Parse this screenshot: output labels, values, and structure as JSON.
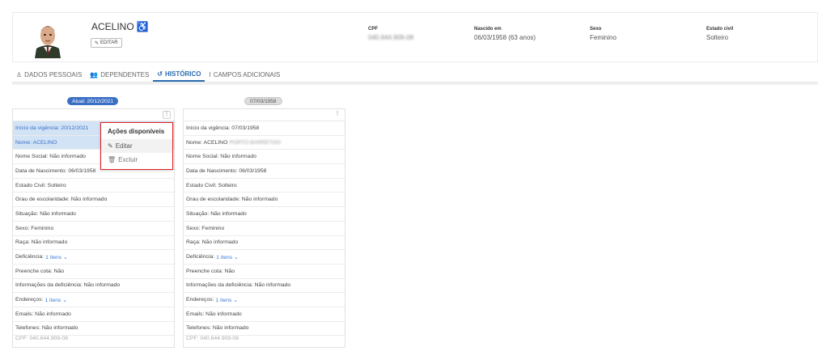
{
  "person": {
    "name": "ACELINO",
    "edit_label": "EDITAR",
    "fields": [
      {
        "label": "CPF",
        "value": "040.644.909-08",
        "blurred": true
      },
      {
        "label": "Nascido em",
        "value": "06/03/1958 (63 anos)",
        "blurred": false
      },
      {
        "label": "Sexo",
        "value": "Feminino",
        "blurred": false
      },
      {
        "label": "Estado civil",
        "value": "Solteiro",
        "blurred": false
      }
    ]
  },
  "tabs": [
    {
      "label": "DADOS PESSOAIS",
      "icon": "person-icon"
    },
    {
      "label": "DEPENDENTES",
      "icon": "group-icon"
    },
    {
      "label": "HISTÓRICO",
      "icon": "history-icon",
      "active": true
    },
    {
      "label": "CAMPOS ADICIONAIS",
      "icon": "text-cursor-icon"
    }
  ],
  "timeline": {
    "current": "Atual: 20/12/2021",
    "previous": "07/03/1958"
  },
  "cards": [
    {
      "rows": [
        {
          "text": "Início da vigência: 20/12/2021",
          "hl": true
        },
        {
          "text": "Nome: ACELINO",
          "hl": true
        },
        {
          "text": "Nome Social: Não informado"
        },
        {
          "text": "Data de Nascimento: 06/03/1958"
        },
        {
          "text": "Estado Civil: Solteiro"
        },
        {
          "text": "Grau de escolaridade: Não informado"
        },
        {
          "text": "Situação: Não informado"
        },
        {
          "text": "Sexo: Feminino"
        },
        {
          "text": "Raça: Não informado"
        },
        {
          "text": "Deficiência:",
          "link": "1 itens ⌄"
        },
        {
          "text": "Preenche cota: Não"
        },
        {
          "text": "Informações da deficiência: Não informado"
        },
        {
          "text": "Endereços:",
          "link": "1 itens ⌄"
        },
        {
          "text": "Emails: Não informado"
        },
        {
          "text": "Telefones: Não informado"
        }
      ],
      "cut": "CPF: 040.644.909-08"
    },
    {
      "rows": [
        {
          "text": "Início da vigência: 07/03/1958"
        },
        {
          "text": "Nome: ACELINO",
          "blur": "PORTO BARRETOO"
        },
        {
          "text": "Nome Social: Não informado"
        },
        {
          "text": "Data de Nascimento: 06/03/1958"
        },
        {
          "text": "Estado Civil: Solteiro"
        },
        {
          "text": "Grau de escolaridade: Não informado"
        },
        {
          "text": "Situação: Não informado"
        },
        {
          "text": "Sexo: Feminino"
        },
        {
          "text": "Raça: Não informado"
        },
        {
          "text": "Deficiência:",
          "link": "1 itens ⌄"
        },
        {
          "text": "Preenche cota: Não"
        },
        {
          "text": "Informações da deficiência: Não informado"
        },
        {
          "text": "Endereços:",
          "link": "1 itens ⌄"
        },
        {
          "text": "Emails: Não informado"
        },
        {
          "text": "Telefones: Não informado"
        }
      ],
      "cut": "CPF: 040.644.909-08"
    }
  ],
  "menu": {
    "title": "Ações disponíveis",
    "items": [
      {
        "label": "Editar",
        "icon": "pencil-icon"
      },
      {
        "label": "Excluir",
        "icon": "trash-icon"
      }
    ]
  },
  "colors": {
    "accent": "#3a6fc4",
    "highlight_row": "#d2e3f6",
    "menu_border": "#e02020"
  }
}
